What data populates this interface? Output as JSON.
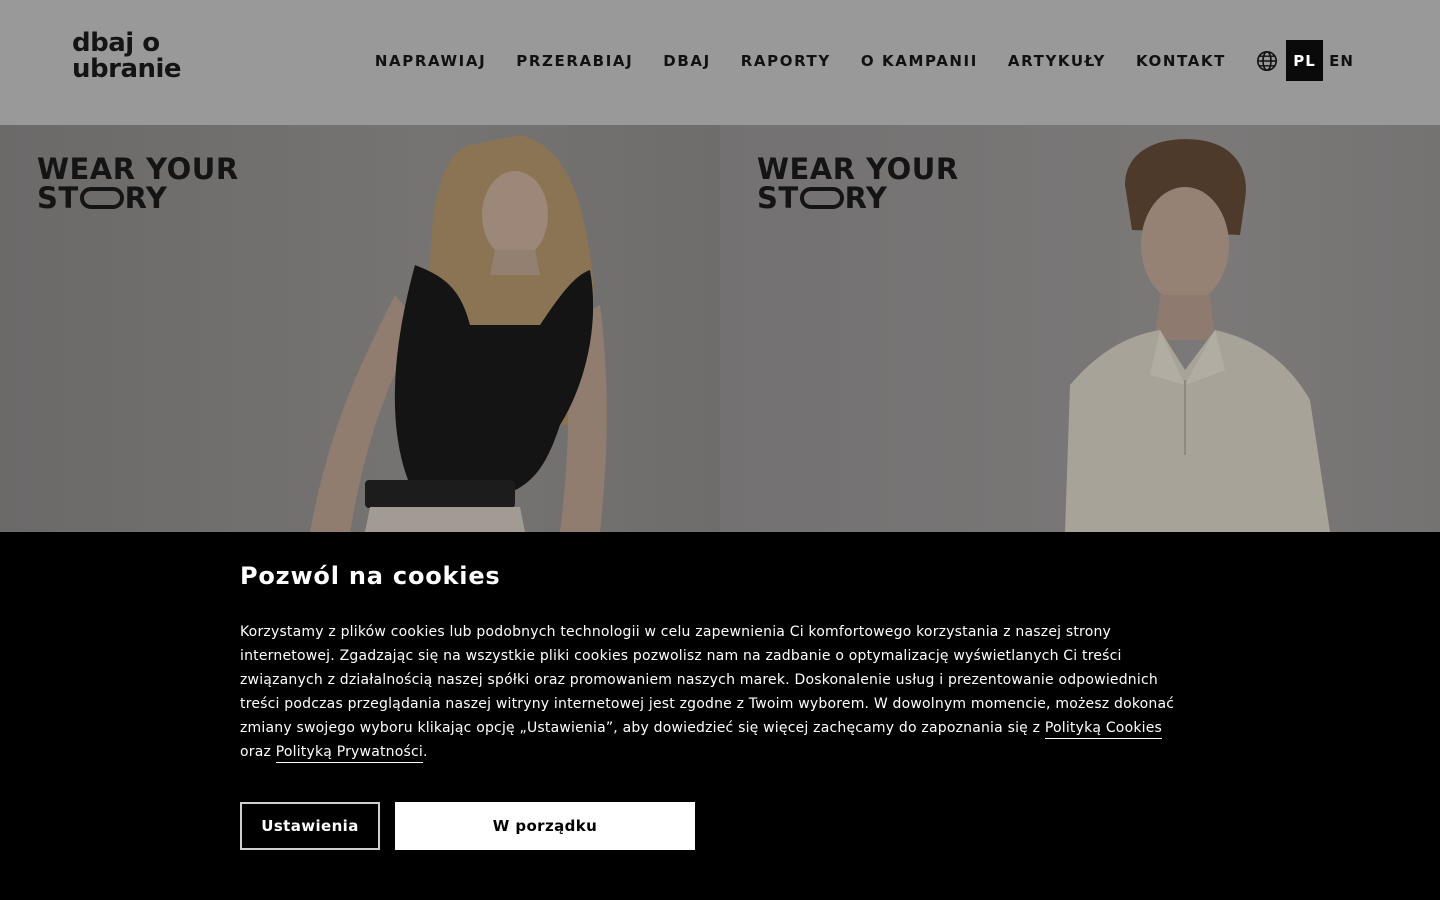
{
  "header": {
    "logo_line1": "dbaj o",
    "logo_line2": "ubranie",
    "nav": [
      "NAPRAWIAJ",
      "PRZERABIAJ",
      "DBAJ",
      "RAPORTY",
      "O KAMPANII",
      "ARTYKUŁY",
      "KONTAKT"
    ],
    "globe_icon": "globe-icon",
    "languages": [
      {
        "label": "PL",
        "active": true
      },
      {
        "label": "EN",
        "active": false
      }
    ]
  },
  "hero": {
    "left": {
      "story_line1": "WEAR YOUR",
      "story_prefix": "ST",
      "story_suffix": "RY"
    },
    "right": {
      "story_line1": "WEAR YOUR",
      "story_prefix": "ST",
      "story_suffix": "RY"
    }
  },
  "cookie": {
    "title": "Pozwól na cookies",
    "text": "Korzystamy z plików cookies lub podobnych technologii w celu zapewnienia Ci komfortowego korzystania z naszej strony internetowej. Zgadzając się na wszystkie pliki cookies pozwolisz nam na zadbanie o optymalizację wyświetlanych Ci treści związanych z działalnością naszej spółki oraz promowaniem naszych marek. Doskonalenie usług i prezentowanie odpowiednich treści podczas przeglądania naszej witryny internetowej jest zgodne z Twoim wyborem. W dowolnym momencie, możesz dokonać zmiany swojego wyboru klikając opcję „Ustawienia”, aby dowiedzieć się więcej zachęcamy do zapoznania się z ",
    "cookies_policy_link": "Polityką Cookies",
    "connector": "oraz ",
    "privacy_policy_link": "Polityką Prywatności",
    "end": ".",
    "settings_button": "Ustawienia",
    "ok_button": "W porządku"
  }
}
